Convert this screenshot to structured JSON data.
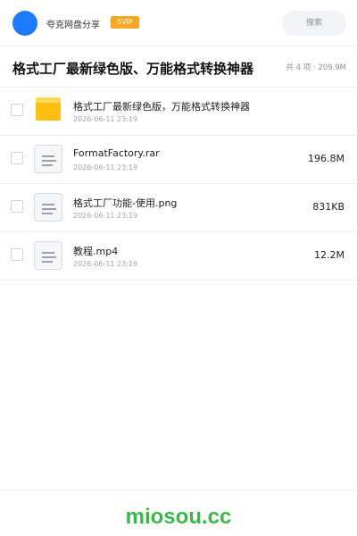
{
  "header": {
    "share_name": "夸克网盘分享",
    "badge": "SVIP",
    "search_placeholder": "搜索"
  },
  "share": {
    "title": "格式工厂最新绿色版、万能格式转换神器",
    "summary": "共 4 项 · 209.9M"
  },
  "files": [
    {
      "name": "格式工厂最新绿色版，万能格式转换神器",
      "date": "2026-06-11 23:19",
      "size": "",
      "type": "folder",
      "icon": "folder-icon"
    },
    {
      "name": "FormatFactory.rar",
      "date": "2026-06-11 23:19",
      "size": "196.8M",
      "type": "file",
      "icon": "file-icon"
    },
    {
      "name": "格式工厂功能-使用.png",
      "date": "2026-06-11 23:19",
      "size": "831KB",
      "type": "file",
      "icon": "file-icon"
    },
    {
      "name": "教程.mp4",
      "date": "2026-06-11 23:19",
      "size": "12.2M",
      "type": "file",
      "icon": "file-icon"
    }
  ],
  "footer": {
    "brand": "miosou.cc"
  },
  "colors": {
    "accent": "#1e7bff",
    "badge": "#f5a623",
    "folder": "#ffbf12",
    "brand": "#3cb64a"
  }
}
